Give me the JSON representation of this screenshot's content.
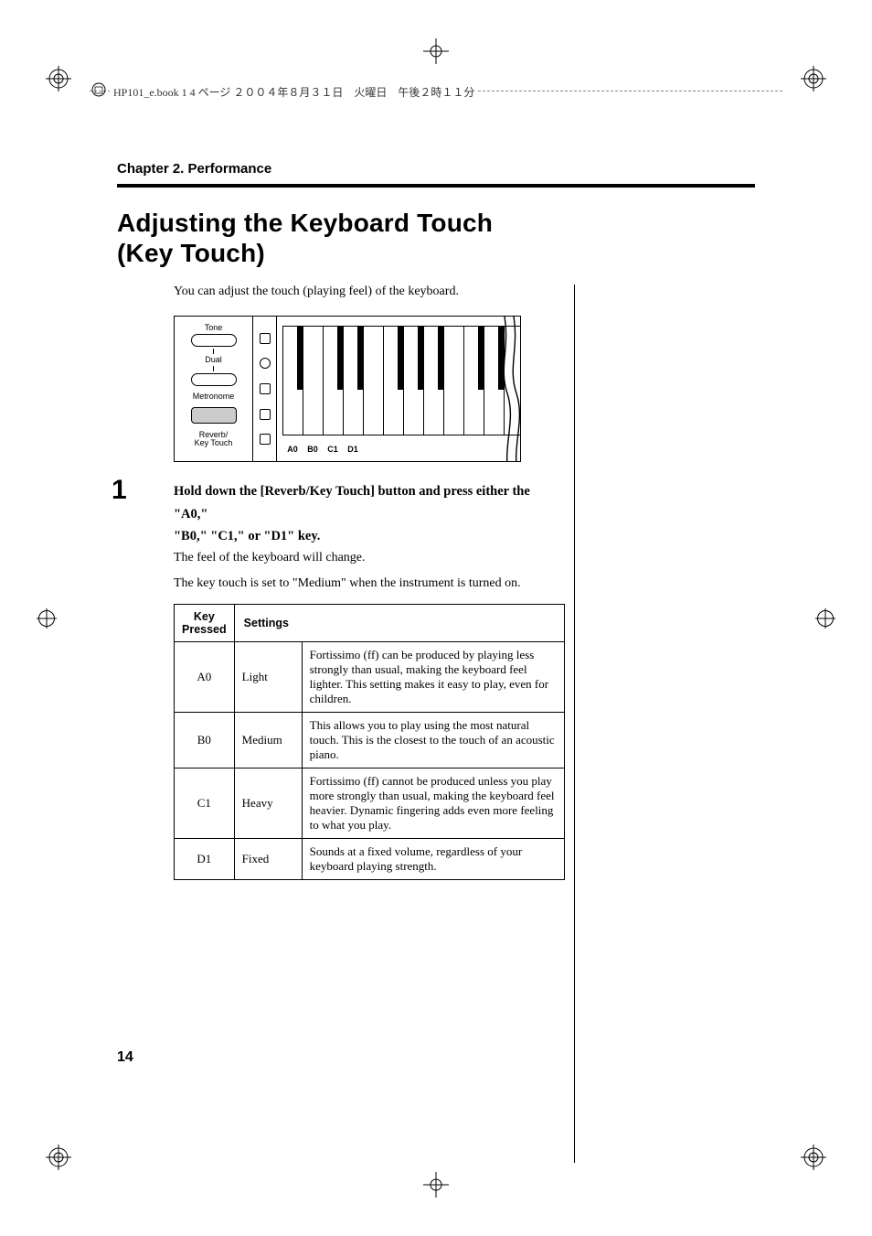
{
  "header_text": "HP101_e.book 1 4 ページ ２００４年８月３１日　火曜日　午後２時１１分",
  "chapter_title": "Chapter 2. Performance",
  "section_title_line1": "Adjusting the Keyboard Touch",
  "section_title_line2": "(Key Touch)",
  "intro_text": "You can adjust the touch (playing feel) of the keyboard.",
  "diagram": {
    "tone": "Tone",
    "dual": "Dual",
    "metronome": "Metronome",
    "reverb": "Reverb/\nKey Touch",
    "key_labels": [
      "A0",
      "B0",
      "C1",
      "D1"
    ]
  },
  "step_number": "1",
  "step_bold_line1": "Hold down the [Reverb/Key Touch] button and press either the \"A0,\"",
  "step_bold_line2": "\"B0,\" \"C1,\" or \"D1\" key.",
  "body_text_1": "The feel of the keyboard will change.",
  "body_text_2": "The key touch is set to \"Medium\" when the instrument is turned on.",
  "table": {
    "headers": {
      "key": "Key\nPressed",
      "settings": "Settings",
      "desc": ""
    },
    "rows": [
      {
        "key": "A0",
        "setting": "Light",
        "desc": "Fortissimo (ff) can be produced by playing less strongly than usual, making the keyboard feel lighter. This setting makes it easy to play, even for children."
      },
      {
        "key": "B0",
        "setting": "Medium",
        "desc": "This allows you to play using the most natural touch. This is the closest to the touch of an acoustic piano."
      },
      {
        "key": "C1",
        "setting": "Heavy",
        "desc": "Fortissimo (ff) cannot be produced unless you play more strongly than usual, making the keyboard feel heavier. Dynamic fingering adds even more feeling to what you play."
      },
      {
        "key": "D1",
        "setting": "Fixed",
        "desc": "Sounds at a fixed volume, regardless of your keyboard playing strength."
      }
    ]
  },
  "page_number": "14"
}
